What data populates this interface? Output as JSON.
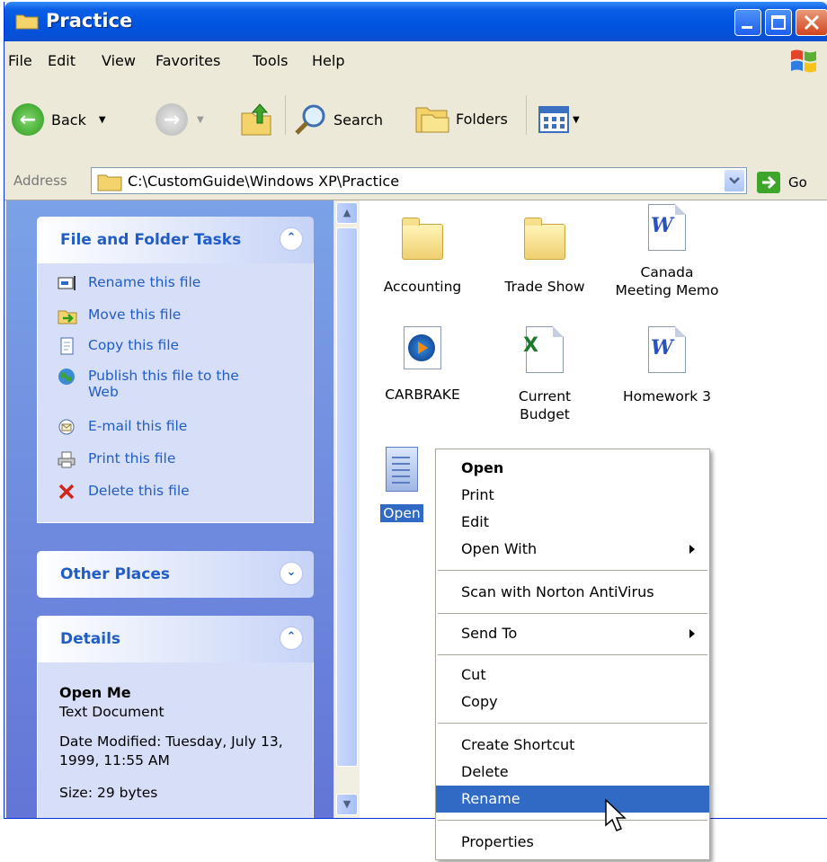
{
  "window": {
    "title": "Practice"
  },
  "menubar": {
    "items": [
      "File",
      "Edit",
      "View",
      "Favorites",
      "Tools",
      "Help"
    ]
  },
  "toolbar": {
    "back_label": "Back",
    "search_label": "Search",
    "folders_label": "Folders"
  },
  "address": {
    "label": "Address",
    "path": "C:\\CustomGuide\\Windows XP\\Practice",
    "go_label": "Go"
  },
  "tasks_panel": {
    "title": "File and Folder Tasks",
    "items": [
      "Rename this file",
      "Move this file",
      "Copy this file",
      "Publish this file to the Web",
      "E-mail this file",
      "Print this file",
      "Delete this file"
    ]
  },
  "other_places": {
    "title": "Other Places"
  },
  "details": {
    "title": "Details",
    "name": "Open Me",
    "type": "Text Document",
    "modified": "Date Modified: Tuesday, July 13, 1999, 11:55 AM",
    "size": "Size: 29 bytes"
  },
  "files": [
    {
      "name": "Accounting",
      "icon": "folder-icon"
    },
    {
      "name": "Trade Show",
      "icon": "folder-icon"
    },
    {
      "name": "Canada Meeting Memo",
      "icon": "word-doc-icon"
    },
    {
      "name": "CARBRAKE",
      "icon": "media-file-icon"
    },
    {
      "name": "Current Budget",
      "icon": "excel-doc-icon"
    },
    {
      "name": "Homework 3",
      "icon": "word-doc-icon"
    },
    {
      "name": "Open",
      "icon": "text-doc-icon"
    }
  ],
  "context_menu": {
    "items": [
      "Open",
      "Print",
      "Edit",
      "Open With",
      "Scan with Norton AntiVirus",
      "Send To",
      "Cut",
      "Copy",
      "Create Shortcut",
      "Delete",
      "Rename",
      "Properties"
    ],
    "highlighted": "Rename"
  },
  "colors": {
    "accent": "#316ac5",
    "title_bar": "#0053e0",
    "task_link": "#215dc6",
    "panel_bg": "#6f8fdf"
  }
}
